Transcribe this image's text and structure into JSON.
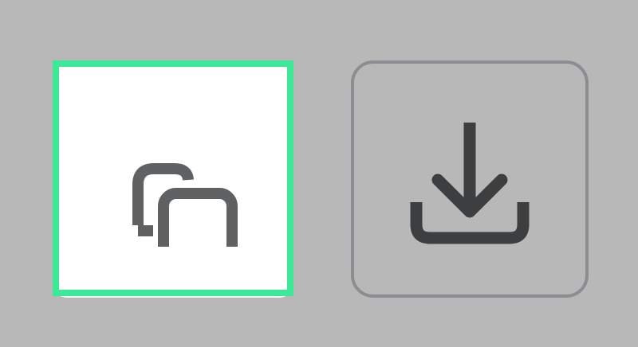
{
  "buttons": [
    {
      "id": "copy",
      "icon": "copy-icon",
      "selected": true
    },
    {
      "id": "download",
      "icon": "download-icon",
      "selected": false
    }
  ],
  "colors": {
    "background": "#b8b8b8",
    "focus_ring": "#3de896",
    "copy_icon": "#5f6163",
    "download_icon": "#3d3e40",
    "download_border": "#8a8d91",
    "tile_fill": "#ffffff"
  }
}
